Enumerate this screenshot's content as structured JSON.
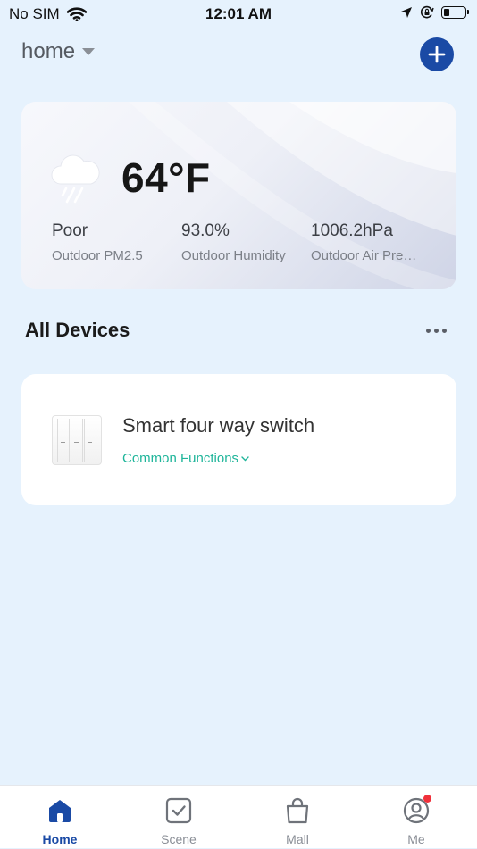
{
  "status_bar": {
    "carrier": "No SIM",
    "time": "12:01 AM"
  },
  "header": {
    "home_label": "home"
  },
  "weather": {
    "temperature": "64°F",
    "metrics": [
      {
        "value": "Poor",
        "name": "Outdoor PM2.5"
      },
      {
        "value": "93.0%",
        "name": "Outdoor Humidity"
      },
      {
        "value": "1006.2hPa",
        "name": "Outdoor Air Pressure"
      }
    ],
    "icon": "rain-cloud-icon"
  },
  "devices": {
    "section_title": "All Devices",
    "items": [
      {
        "name": "Smart four way switch",
        "functions_label": "Common Functions",
        "icon": "four-way-switch-icon"
      }
    ]
  },
  "bottom_nav": {
    "items": [
      {
        "label": "Home",
        "icon": "home-icon",
        "active": true
      },
      {
        "label": "Scene",
        "icon": "scene-checkbox-icon",
        "active": false
      },
      {
        "label": "Mall",
        "icon": "shopping-bag-icon",
        "active": false
      },
      {
        "label": "Me",
        "icon": "user-profile-icon",
        "active": false
      }
    ]
  },
  "colors": {
    "background": "#e6f2fd",
    "accent": "#1a4aa5",
    "functions_link": "#1fb59a",
    "notification": "#f0303a"
  }
}
